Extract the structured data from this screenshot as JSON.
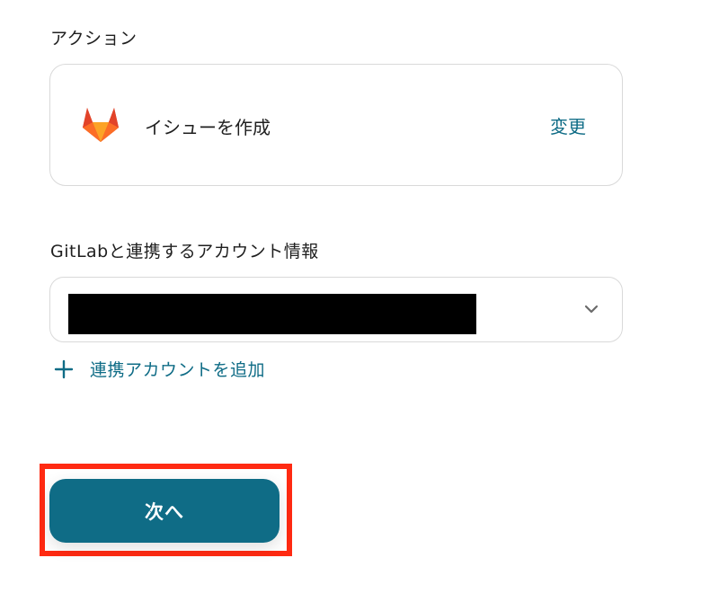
{
  "action_section": {
    "label": "アクション",
    "action_name": "イシューを作成",
    "change_label": "変更",
    "logo_icon": "gitlab-logo"
  },
  "account_section": {
    "label": "GitLabと連携するアカウント情報",
    "selected_value": "",
    "add_account_label": "連携アカウントを追加"
  },
  "footer": {
    "next_label": "次へ"
  },
  "colors": {
    "accent": "#0f6c86",
    "highlight": "#ff2a12",
    "gitlab_orange": "#e24329"
  }
}
